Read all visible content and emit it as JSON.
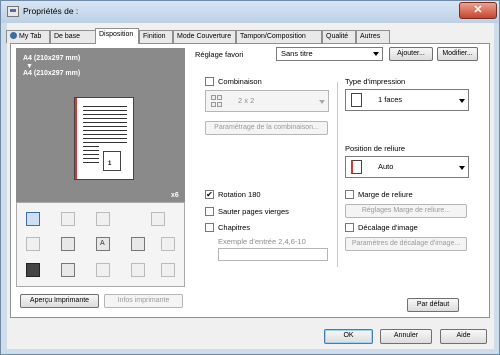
{
  "window": {
    "title": "Propriétés de :",
    "close_glyph": "✕"
  },
  "tabs": [
    {
      "label": "My Tab"
    },
    {
      "label": "De base"
    },
    {
      "label": "Disposition"
    },
    {
      "label": "Finition"
    },
    {
      "label": "Mode Couverture"
    },
    {
      "label": "Tampon/Composition"
    },
    {
      "label": "Qualité"
    },
    {
      "label": "Autres"
    }
  ],
  "active_tab": "Disposition",
  "favorite": {
    "label": "Réglage favori",
    "value": "Sans titre",
    "add_label": "Ajouter...",
    "modify_label": "Modifier..."
  },
  "preview": {
    "paper_top": "A4 (210x297 mm)",
    "arrow": "▼",
    "paper_bottom": "A4 (210x297 mm)",
    "copies": "x6",
    "page_number": "1"
  },
  "combination": {
    "label": "Combinaison",
    "value": "2 x 2",
    "settings_label": "Paramétrage de la combinaison..."
  },
  "print_type": {
    "label": "Type d'impression",
    "value": "1 faces"
  },
  "binding_position": {
    "label": "Position de reliure",
    "value": "Auto"
  },
  "options": {
    "rotation_label": "Rotation 180",
    "rotation_checked": true,
    "skip_blank_label": "Sauter pages vierges",
    "chapters_label": "Chapitres",
    "chapters_example": "Exemple d'entrée 2,4,6-10"
  },
  "margin": {
    "label": "Marge de reliure",
    "settings_label": "Réglages Marge de reliure..."
  },
  "shift": {
    "label": "Décalage d'image",
    "settings_label": "Paramètres de décalage d'image..."
  },
  "bottom": {
    "preview_label": "Aperçu Imprimante",
    "info_label": "Infos imprimante",
    "default_label": "Par défaut"
  },
  "dialog_buttons": {
    "ok": "OK",
    "cancel": "Annuler",
    "help": "Aide"
  },
  "checkmark": "✔"
}
